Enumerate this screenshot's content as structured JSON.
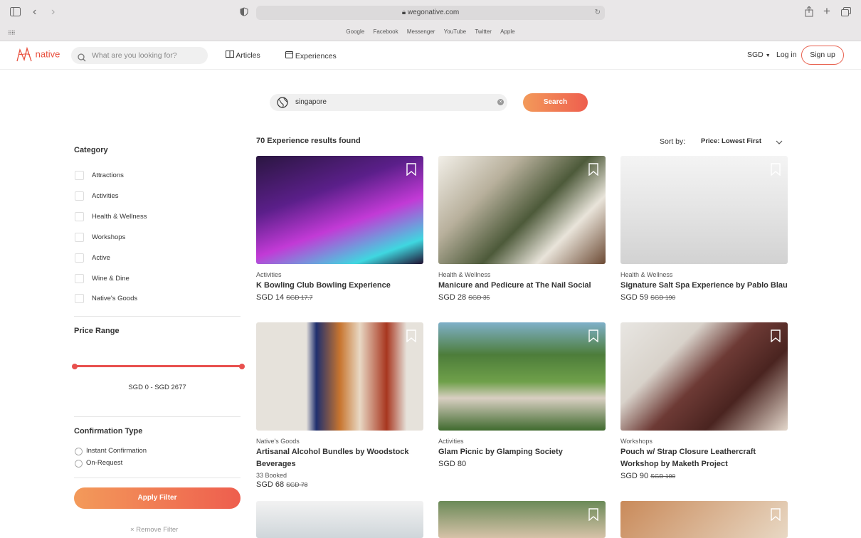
{
  "browser": {
    "url": "wegonative.com",
    "favorites": [
      "Google",
      "Facebook",
      "Messenger",
      "YouTube",
      "Twitter",
      "Apple"
    ]
  },
  "nav": {
    "logo_text": "native",
    "search_placeholder": "What are you looking for?",
    "articles": "Articles",
    "experiences": "Experiences",
    "currency": "SGD",
    "login": "Log in",
    "signup": "Sign up",
    "accent_color": "#e8503e"
  },
  "search": {
    "value": "singapore",
    "button": "Search"
  },
  "filters": {
    "category_title": "Category",
    "categories": [
      "Attractions",
      "Activities",
      "Health & Wellness",
      "Workshops",
      "Active",
      "Wine & Dine",
      "Native's Goods"
    ],
    "price_title": "Price Range",
    "price_label": "SGD 0 - SGD 2677",
    "price_min": 0,
    "price_max": 2677,
    "confirmation_title": "Confirmation Type",
    "confirmation_options": [
      "Instant Confirmation",
      "On-Request"
    ],
    "apply": "Apply Filter",
    "remove": "Remove Filter"
  },
  "results": {
    "count_text": "70 Experience results found",
    "sort_label": "Sort by:",
    "sort_value": "Price: Lowest First"
  },
  "cards": [
    {
      "category": "Activities",
      "title": "K Bowling Club Bowling Experience",
      "price": "SGD 14",
      "old_price": "SGD 17.7",
      "booked": ""
    },
    {
      "category": "Health & Wellness",
      "title": "Manicure and Pedicure at The Nail Social",
      "price": "SGD 28",
      "old_price": "SGD 35",
      "booked": ""
    },
    {
      "category": "Health & Wellness",
      "title": "Signature Salt Spa Experience by Pablo Blau",
      "price": "SGD 59",
      "old_price": "SGD 190",
      "booked": ""
    },
    {
      "category": "Native's Goods",
      "title": "Artisanal Alcohol Bundles by Woodstock Beverages",
      "price": "SGD 68",
      "old_price": "SGD 78",
      "booked": "33 Booked"
    },
    {
      "category": "Activities",
      "title": "Glam Picnic by Glamping Society",
      "price": "SGD 80",
      "old_price": "",
      "booked": ""
    },
    {
      "category": "Workshops",
      "title": "Pouch w/ Strap Closure Leathercraft Workshop by Maketh Project",
      "price": "SGD 90",
      "old_price": "SGD 100",
      "booked": ""
    }
  ]
}
